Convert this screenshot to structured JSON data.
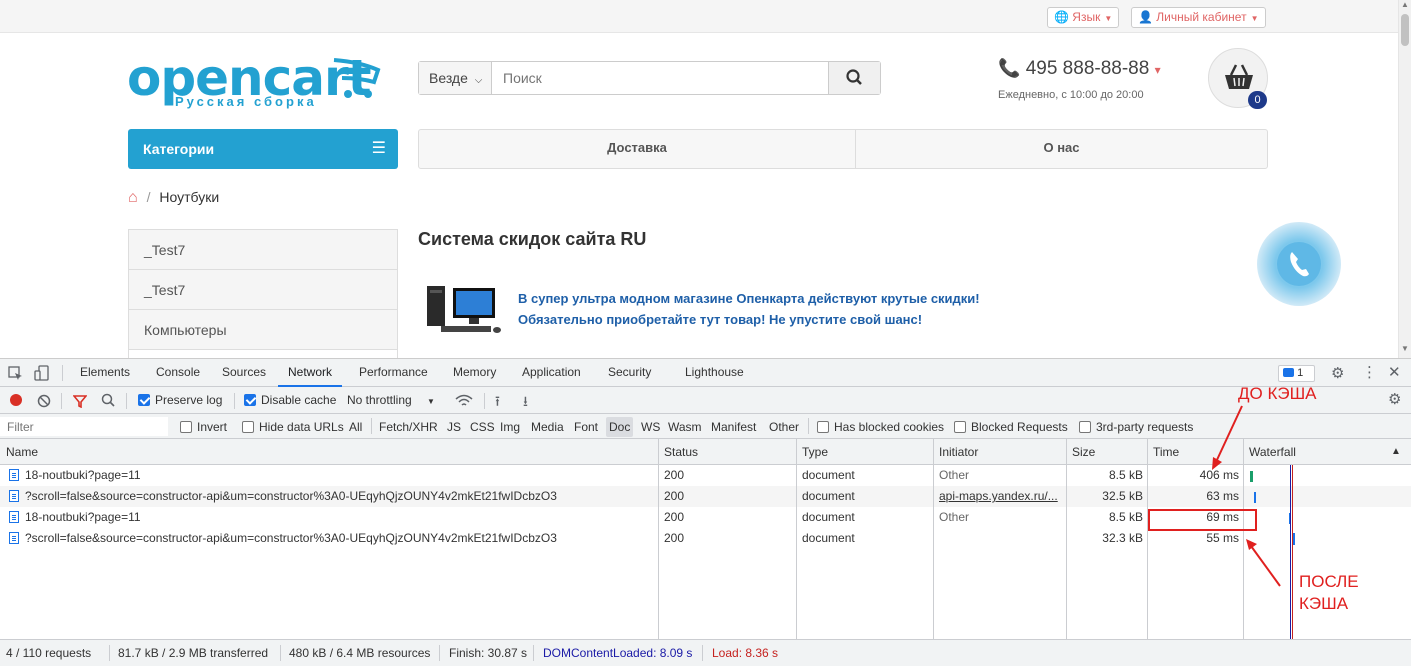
{
  "site": {
    "top": {
      "language": "Язык",
      "account": "Личный кабинет"
    },
    "logo": {
      "name": "opencart",
      "subtitle": "Русская сборка"
    },
    "search": {
      "scope": "Везде",
      "placeholder": "Поиск"
    },
    "phone": {
      "number": "495 888-88-88",
      "hours": "Ежедневно, с 10:00 до 20:00"
    },
    "cart": {
      "count": "0"
    },
    "categories_label": "Категории",
    "menu": [
      "Доставка",
      "О нас"
    ],
    "breadcrumb": {
      "current": "Ноутбуки"
    },
    "category_list": [
      "_Test7",
      "_Test7",
      "Компьютеры"
    ],
    "heading": "Система скидок сайта RU",
    "promo": [
      "В супер ультра модном магазине Опенкарта действуют крутые скидки!",
      "Обязательно приобретайте тут товар! Не упустите свой шанс!"
    ]
  },
  "devtools": {
    "tabs": [
      "Elements",
      "Console",
      "Sources",
      "Network",
      "Performance",
      "Memory",
      "Application",
      "Security",
      "Lighthouse"
    ],
    "active_tab": "Network",
    "issues_count": "1",
    "toolbar": {
      "preserve_log": "Preserve log",
      "disable_cache": "Disable cache",
      "throttling": "No throttling"
    },
    "filter": {
      "placeholder": "Filter",
      "invert": "Invert",
      "hide_data_urls": "Hide data URLs",
      "types": [
        "All",
        "Fetch/XHR",
        "JS",
        "CSS",
        "Img",
        "Media",
        "Font",
        "Doc",
        "WS",
        "Wasm",
        "Manifest",
        "Other"
      ],
      "active_type": "Doc",
      "has_blocked_cookies": "Has blocked cookies",
      "blocked_requests": "Blocked Requests",
      "third_party": "3rd-party requests"
    },
    "columns": [
      "Name",
      "Status",
      "Type",
      "Initiator",
      "Size",
      "Time",
      "Waterfall"
    ],
    "rows": [
      {
        "name": "18-noutbuki?page=11",
        "status": "200",
        "type": "document",
        "initiator": "Other",
        "size": "8.5 kB",
        "time": "406 ms"
      },
      {
        "name": "?scroll=false&source=constructor-api&um=constructor%3A0-UEqyhQjzOUNY4v2mkEt21fwIDcbzO3",
        "status": "200",
        "type": "document",
        "initiator": "api-maps.yandex.ru/...",
        "size": "32.5 kB",
        "time": "63 ms"
      },
      {
        "name": "18-noutbuki?page=11",
        "status": "200",
        "type": "document",
        "initiator": "Other",
        "size": "8.5 kB",
        "time": "69 ms"
      },
      {
        "name": "?scroll=false&source=constructor-api&um=constructor%3A0-UEqyhQjzOUNY4v2mkEt21fwIDcbzO3",
        "status": "200",
        "type": "document",
        "initiator": "",
        "size": "32.3 kB",
        "time": "55 ms"
      }
    ],
    "status": {
      "requests": "4 / 110 requests",
      "transferred": "81.7 kB / 2.9 MB transferred",
      "resources": "480 kB / 6.4 MB resources",
      "finish": "Finish: 30.87 s",
      "dcl": "DOMContentLoaded: 8.09 s",
      "load": "Load: 8.36 s"
    }
  },
  "annotations": {
    "before_cache": "ДО КЭША",
    "after_cache_1": "ПОСЛЕ",
    "after_cache_2": "КЭША"
  },
  "colors": {
    "brand": "#23a1d1",
    "accent_red": "#e0201f",
    "dcl_blue": "#1a1aa6",
    "load_red": "#c5221f"
  }
}
